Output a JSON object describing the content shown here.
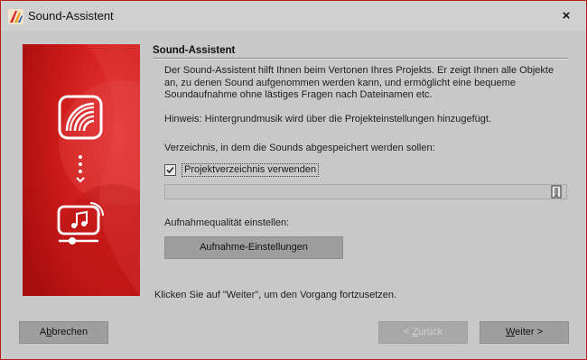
{
  "window": {
    "title": "Sound-Assistent",
    "close_glyph": "×",
    "accent_color": "#b41c1c"
  },
  "hero": {
    "icons": [
      "sound-waves-icon",
      "progress-dots-icon",
      "music-monitor-icon"
    ]
  },
  "content": {
    "heading": "Sound-Assistent",
    "intro_line1": "Der Sound-Assistent hilft Ihnen beim Vertonen Ihres Projekts. Er zeigt Ihnen alle Objekte",
    "intro_line2": "an, zu denen Sound aufgenommen werden kann, und ermöglicht eine bequeme",
    "intro_line3": "Soundaufnahme ohne lästiges Fragen nach Dateinamen etc.",
    "hint": "Hinweis: Hintergrundmusik wird über die Projekteinstellungen hinzugefügt.",
    "directory_label": "Verzeichnis, in dem die Sounds abgespeichert werden sollen:",
    "checkbox_label": "Projektverzeichnis verwenden",
    "checkbox_checked": true,
    "path_value": "",
    "quality_label": "Aufnahmequalität einstellen:",
    "settings_button": "Aufnahme-Einstellungen",
    "footer_text": "Klicken Sie auf \"Weiter\", um den Vorgang fortzusetzen."
  },
  "buttons": {
    "cancel_pre": "A",
    "cancel_mnemonic": "b",
    "cancel_post": "brechen",
    "back_pre": "< ",
    "back_mnemonic": "Z",
    "back_post": "urück",
    "back_enabled": false,
    "next_mnemonic": "W",
    "next_post": "eiter >"
  }
}
